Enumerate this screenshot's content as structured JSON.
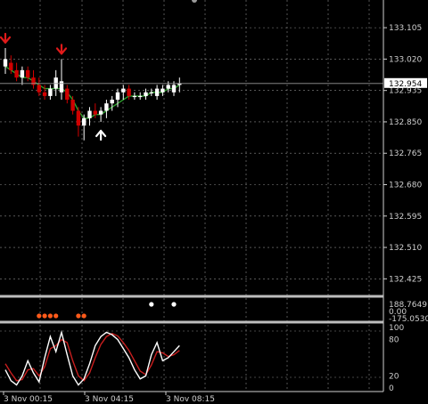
{
  "colors": {
    "background": "#000000",
    "grid": "#8a8a8a",
    "separator": "#bdbdbd",
    "bull_candle": "#ffffff",
    "bear_candle": "#d00000",
    "ma_line": "#2ea02e",
    "ma_line_2": "#c83a2a",
    "up_arrow": "#ffffff",
    "down_arrow": "#e01a1a",
    "osc_dot_low": "#ff5a1a",
    "osc_dot_high": "#ffffff",
    "stoch_main": "#ffffff",
    "stoch_signal": "#c81e1e",
    "price_line": "#9a9a9a",
    "price_box": "#ffffff"
  },
  "chart_data": {
    "type": "candlestick",
    "y_ticks": [
      "133.105",
      "133.020",
      "132.935",
      "132.850",
      "132.765",
      "132.680",
      "132.595",
      "132.510",
      "132.425"
    ],
    "ylim": [
      132.38,
      133.18
    ],
    "current_price": "132.954",
    "x_ticks": [
      "3 Nov 00:15",
      "3 Nov 04:15",
      "3 Nov 08:15"
    ],
    "candles": [
      {
        "o": 133.0,
        "h": 133.05,
        "l": 132.98,
        "c": 133.02
      },
      {
        "o": 133.01,
        "h": 133.03,
        "l": 132.98,
        "c": 132.99
      },
      {
        "o": 132.99,
        "h": 133.01,
        "l": 132.96,
        "c": 132.97
      },
      {
        "o": 132.97,
        "h": 133.0,
        "l": 132.95,
        "c": 132.99
      },
      {
        "o": 132.99,
        "h": 133.0,
        "l": 132.96,
        "c": 132.97
      },
      {
        "o": 132.97,
        "h": 132.99,
        "l": 132.94,
        "c": 132.95
      },
      {
        "o": 132.95,
        "h": 132.97,
        "l": 132.92,
        "c": 132.93
      },
      {
        "o": 132.93,
        "h": 132.95,
        "l": 132.91,
        "c": 132.92
      },
      {
        "o": 132.92,
        "h": 132.95,
        "l": 132.91,
        "c": 132.94
      },
      {
        "o": 132.94,
        "h": 132.99,
        "l": 132.92,
        "c": 132.97
      },
      {
        "o": 132.93,
        "h": 133.02,
        "l": 132.91,
        "c": 132.96
      },
      {
        "o": 132.94,
        "h": 132.95,
        "l": 132.9,
        "c": 132.91
      },
      {
        "o": 132.91,
        "h": 132.92,
        "l": 132.87,
        "c": 132.88
      },
      {
        "o": 132.88,
        "h": 132.89,
        "l": 132.81,
        "c": 132.84
      },
      {
        "o": 132.84,
        "h": 132.87,
        "l": 132.8,
        "c": 132.86
      },
      {
        "o": 132.86,
        "h": 132.89,
        "l": 132.84,
        "c": 132.88
      },
      {
        "o": 132.88,
        "h": 132.9,
        "l": 132.86,
        "c": 132.87
      },
      {
        "o": 132.87,
        "h": 132.89,
        "l": 132.85,
        "c": 132.88
      },
      {
        "o": 132.88,
        "h": 132.91,
        "l": 132.86,
        "c": 132.9
      },
      {
        "o": 132.9,
        "h": 132.92,
        "l": 132.88,
        "c": 132.91
      },
      {
        "o": 132.91,
        "h": 132.94,
        "l": 132.89,
        "c": 132.93
      },
      {
        "o": 132.93,
        "h": 132.95,
        "l": 132.91,
        "c": 132.94
      },
      {
        "o": 132.94,
        "h": 132.95,
        "l": 132.91,
        "c": 132.92
      },
      {
        "o": 132.92,
        "h": 132.93,
        "l": 132.91,
        "c": 132.92
      },
      {
        "o": 132.92,
        "h": 132.93,
        "l": 132.91,
        "c": 132.92
      },
      {
        "o": 132.92,
        "h": 132.94,
        "l": 132.91,
        "c": 132.93
      },
      {
        "o": 132.93,
        "h": 132.94,
        "l": 132.92,
        "c": 132.93
      },
      {
        "o": 132.92,
        "h": 132.95,
        "l": 132.91,
        "c": 132.94
      },
      {
        "o": 132.93,
        "h": 132.95,
        "l": 132.92,
        "c": 132.94
      },
      {
        "o": 132.94,
        "h": 132.96,
        "l": 132.93,
        "c": 132.95
      },
      {
        "o": 132.93,
        "h": 132.96,
        "l": 132.92,
        "c": 132.95
      },
      {
        "o": 132.95,
        "h": 132.97,
        "l": 132.93,
        "c": 132.954
      }
    ],
    "moving_average": [
      133.0,
      132.99,
      132.98,
      132.97,
      132.97,
      132.96,
      132.95,
      132.94,
      132.94,
      132.94,
      132.94,
      132.93,
      132.91,
      132.88,
      132.86,
      132.86,
      132.87,
      132.87,
      132.88,
      132.89,
      132.9,
      132.91,
      132.92,
      132.92,
      132.92,
      132.92,
      132.93,
      132.93,
      132.93,
      132.94,
      132.94,
      132.95
    ],
    "arrows": [
      {
        "index": 0,
        "dir": "down"
      },
      {
        "index": 10,
        "dir": "down"
      },
      {
        "index": 17,
        "dir": "up"
      }
    ],
    "osc_panel": {
      "y_ticks": [
        "188.7649",
        "0.00",
        "-175.0530"
      ],
      "dots_low": [
        6,
        7,
        8,
        9,
        13,
        14
      ],
      "dots_high": [
        26,
        30
      ]
    },
    "stoch_panel": {
      "y_ticks": [
        "100",
        "80",
        "20",
        "0"
      ],
      "ylim": [
        0,
        100
      ],
      "main": [
        30,
        12,
        5,
        20,
        45,
        25,
        10,
        50,
        85,
        60,
        92,
        55,
        20,
        5,
        15,
        40,
        70,
        85,
        92,
        88,
        80,
        65,
        50,
        30,
        15,
        20,
        55,
        75,
        45,
        50,
        60,
        70
      ],
      "signal": [
        40,
        25,
        12,
        14,
        30,
        32,
        20,
        35,
        65,
        70,
        80,
        75,
        45,
        20,
        12,
        25,
        50,
        72,
        85,
        90,
        86,
        75,
        62,
        45,
        28,
        22,
        38,
        60,
        58,
        52,
        55,
        62
      ]
    }
  }
}
